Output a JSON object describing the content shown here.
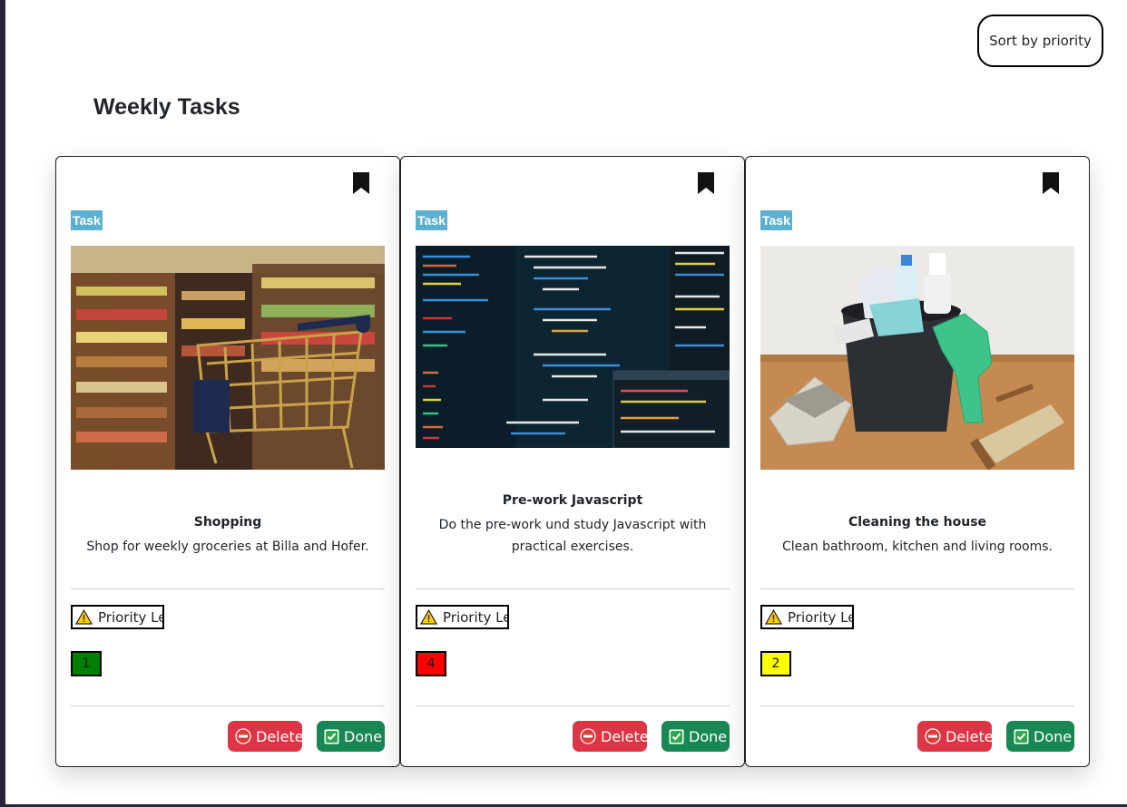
{
  "toolbar": {
    "sort_label": "Sort by priority"
  },
  "page": {
    "title": "Weekly Tasks"
  },
  "colors": {
    "badge": "#5bb0d0",
    "delete": "#dc3545",
    "done": "#198754",
    "priority_low": "#008000",
    "priority_high": "#ff0000",
    "priority_mid": "#ffff00"
  },
  "cards": [
    {
      "badge": "Task",
      "image": "shopping cart in supermarket aisle",
      "title": "Shopping",
      "description": "Shop for weekly groceries at Billa and Hofer.",
      "priority_label": "Priority Level",
      "priority_value": "1",
      "priority_color": "#008000",
      "delete_label": "Delete",
      "done_label": "Done"
    },
    {
      "badge": "Task",
      "image": "code editor with javascript source",
      "title": "Pre-work Javascript",
      "description": "Do the pre-work und study Javascript with practical exercises.",
      "priority_label": "Priority Level",
      "priority_value": "4",
      "priority_color": "#ff0000",
      "delete_label": "Delete",
      "done_label": "Done"
    },
    {
      "badge": "Task",
      "image": "cleaning bucket with gloves and brush",
      "title": "Cleaning the house",
      "description": "Clean bathroom, kitchen and living rooms.",
      "priority_label": "Priority Level",
      "priority_value": "2",
      "priority_color": "#ffff00",
      "delete_label": "Delete",
      "done_label": "Done"
    }
  ]
}
